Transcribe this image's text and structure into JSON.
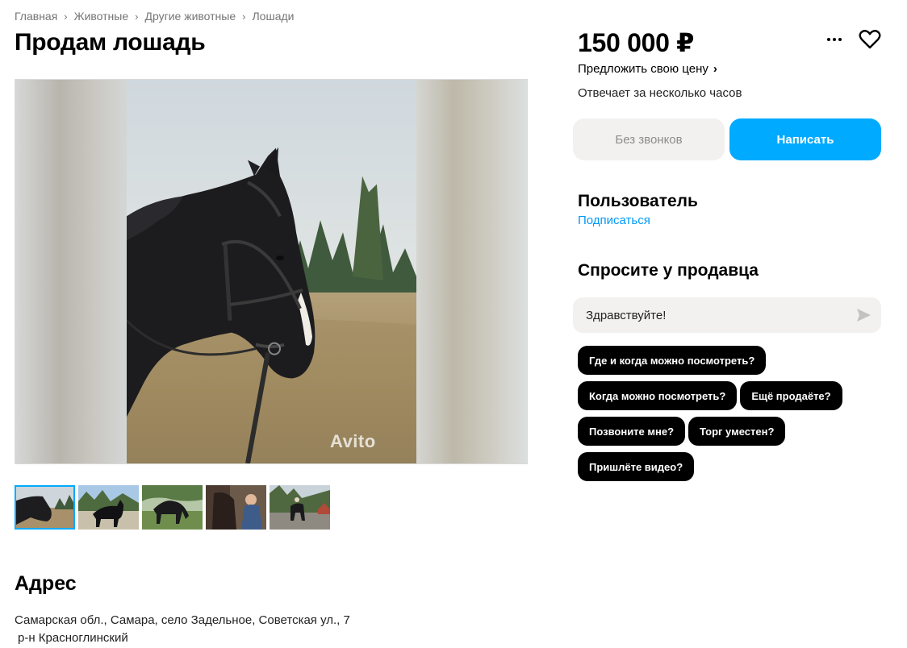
{
  "breadcrumb": [
    "Главная",
    "Животные",
    "Другие животные",
    "Лошади"
  ],
  "listing": {
    "title": "Продам лошадь",
    "price": "150 000 ₽",
    "offer_price_label": "Предложить свою цену",
    "responds": "Отвечает за несколько часов"
  },
  "gallery": {
    "watermark": "Avito",
    "thumbnail_count": 5,
    "active_thumbnail": 1
  },
  "actions": {
    "no_calls_label": "Без звонков",
    "write_label": "Написать"
  },
  "seller": {
    "name": "Пользователь",
    "subscribe_label": "Подписаться"
  },
  "ask": {
    "title": "Спросите у продавца",
    "message_value": "Здравствуйте!",
    "quick_questions": [
      "Где и когда можно посмотреть?",
      "Когда можно посмотреть?",
      "Ещё продаёте?",
      "Позвоните мне?",
      "Торг уместен?",
      "Пришлёте видео?"
    ]
  },
  "address": {
    "title": "Адрес",
    "line": "Самарская обл., Самара, село Задельное, Советская ул., 7",
    "district": "р-н Красноглинский"
  },
  "icons": {
    "more": "more-dots-icon",
    "favorite": "heart-icon",
    "send": "send-arrow-icon",
    "chevron": "chevron-right-icon"
  },
  "colors": {
    "accent": "#00aaff",
    "link": "#0099f7",
    "chip_bg": "#000000",
    "secondary_button_bg": "#f2f1f0"
  }
}
